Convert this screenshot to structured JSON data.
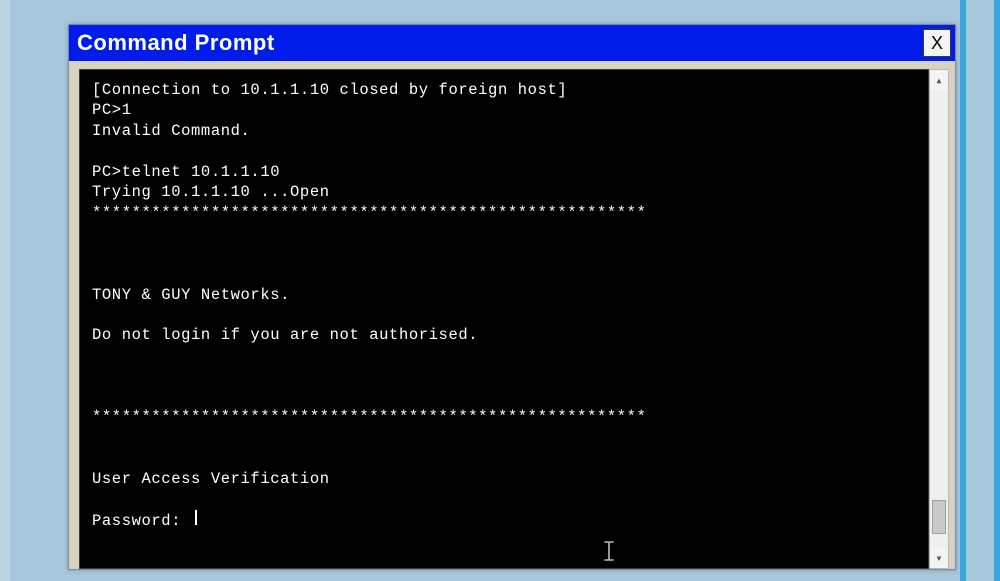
{
  "window": {
    "title": "Command Prompt",
    "close_label": "X"
  },
  "terminal": {
    "lines": [
      "[Connection to 10.1.1.10 closed by foreign host]",
      "PC>1",
      "Invalid Command.",
      "",
      "PC>telnet 10.1.1.10",
      "Trying 10.1.1.10 ...Open",
      "********************************************************",
      "",
      "",
      "",
      "TONY & GUY Networks.",
      "",
      "Do not login if you are not authorised.",
      "",
      "",
      "",
      "********************************************************",
      "",
      "",
      "User Access Verification",
      ""
    ],
    "prompt_label": "Password: "
  },
  "scrollbar": {
    "up": "▴",
    "down": "▾"
  }
}
